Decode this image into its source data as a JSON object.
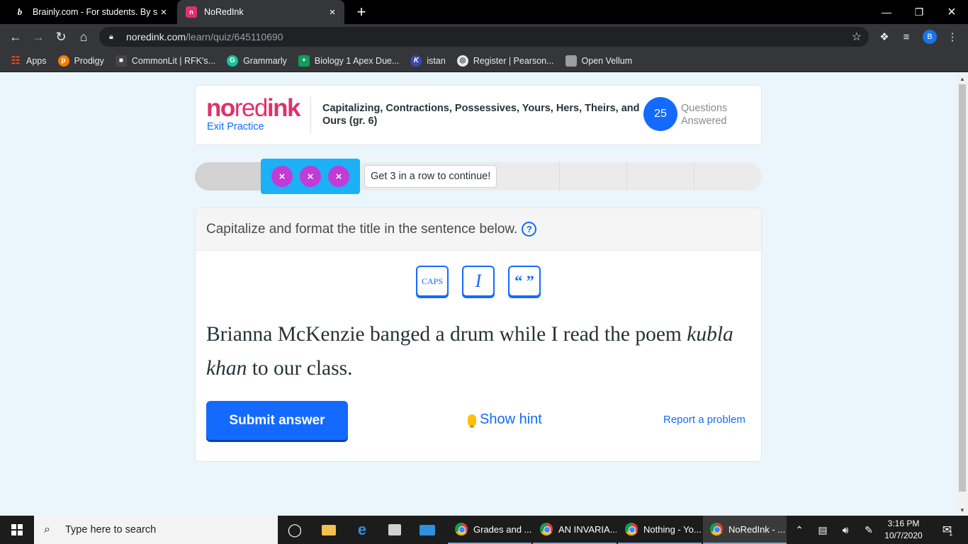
{
  "browser": {
    "tabs": [
      {
        "title": "Brainly.com - For students. By students",
        "favicon": "brainly-b"
      },
      {
        "title": "NoRedInk",
        "favicon": "noredink-n"
      }
    ],
    "url_host": "noredink.com",
    "url_path": "/learn/quiz/645110690",
    "profile_initial": "B",
    "bookmarks": [
      {
        "label": "Apps",
        "icon": "apps-grid-icon",
        "color": "#f4511e"
      },
      {
        "label": "Prodigy",
        "icon": "prodigy-icon",
        "color": "#f57c00"
      },
      {
        "label": "CommonLit | RFK's...",
        "icon": "commonlit-icon",
        "color": "#444444"
      },
      {
        "label": "Grammarly",
        "icon": "grammarly-icon",
        "color": "#15c39a"
      },
      {
        "label": "Biology 1 Apex Due...",
        "icon": "biology-icon",
        "color": "#0f9d58"
      },
      {
        "label": "istan",
        "icon": "k-icon",
        "color": "#3949ab"
      },
      {
        "label": "Register | Pearson...",
        "icon": "pearson-icon",
        "color": "#5f6368"
      },
      {
        "label": "Open Vellum",
        "icon": "vellum-icon",
        "color": "#9e9e9e"
      }
    ]
  },
  "page": {
    "logo": {
      "part1": "no",
      "part2": "red",
      "part3": "ink"
    },
    "exit_label": "Exit Practice",
    "quiz_title": "Capitalizing, Contractions, Possessives, Yours, Hers, Theirs, and Ours (gr. 6)",
    "questions_answered_count": "25",
    "questions_answered_label": "Questions Answered",
    "progress_fraction": 0.12,
    "streak_marks": [
      "×",
      "×",
      "×"
    ],
    "tooltip": "Get 3 in a row to continue!",
    "instruction": "Capitalize and format the title in the sentence below.",
    "help": "?",
    "format_buttons": {
      "caps": "CAPS",
      "italic": "I",
      "quotes": "“ ”"
    },
    "sentence_before": "Brianna McKenzie banged a drum while I read the poem ",
    "sentence_italic": "kubla khan",
    "sentence_after": " to our class.",
    "submit_label": "Submit answer",
    "hint_label": "Show hint",
    "report_label": "Report a problem"
  },
  "taskbar": {
    "search_placeholder": "Type here to search",
    "apps": [
      {
        "label": "Grades and ..."
      },
      {
        "label": "AN INVARIA..."
      },
      {
        "label": "Nothing - Yo..."
      },
      {
        "label": "NoRedInk - ..."
      }
    ],
    "time": "3:16 PM",
    "date": "10/7/2020",
    "notification_count": "1"
  },
  "colors": {
    "accent": "#146aff",
    "brand": "#e1306c",
    "streak": "#1cb0f6",
    "streak_mark": "#c13bd6"
  }
}
